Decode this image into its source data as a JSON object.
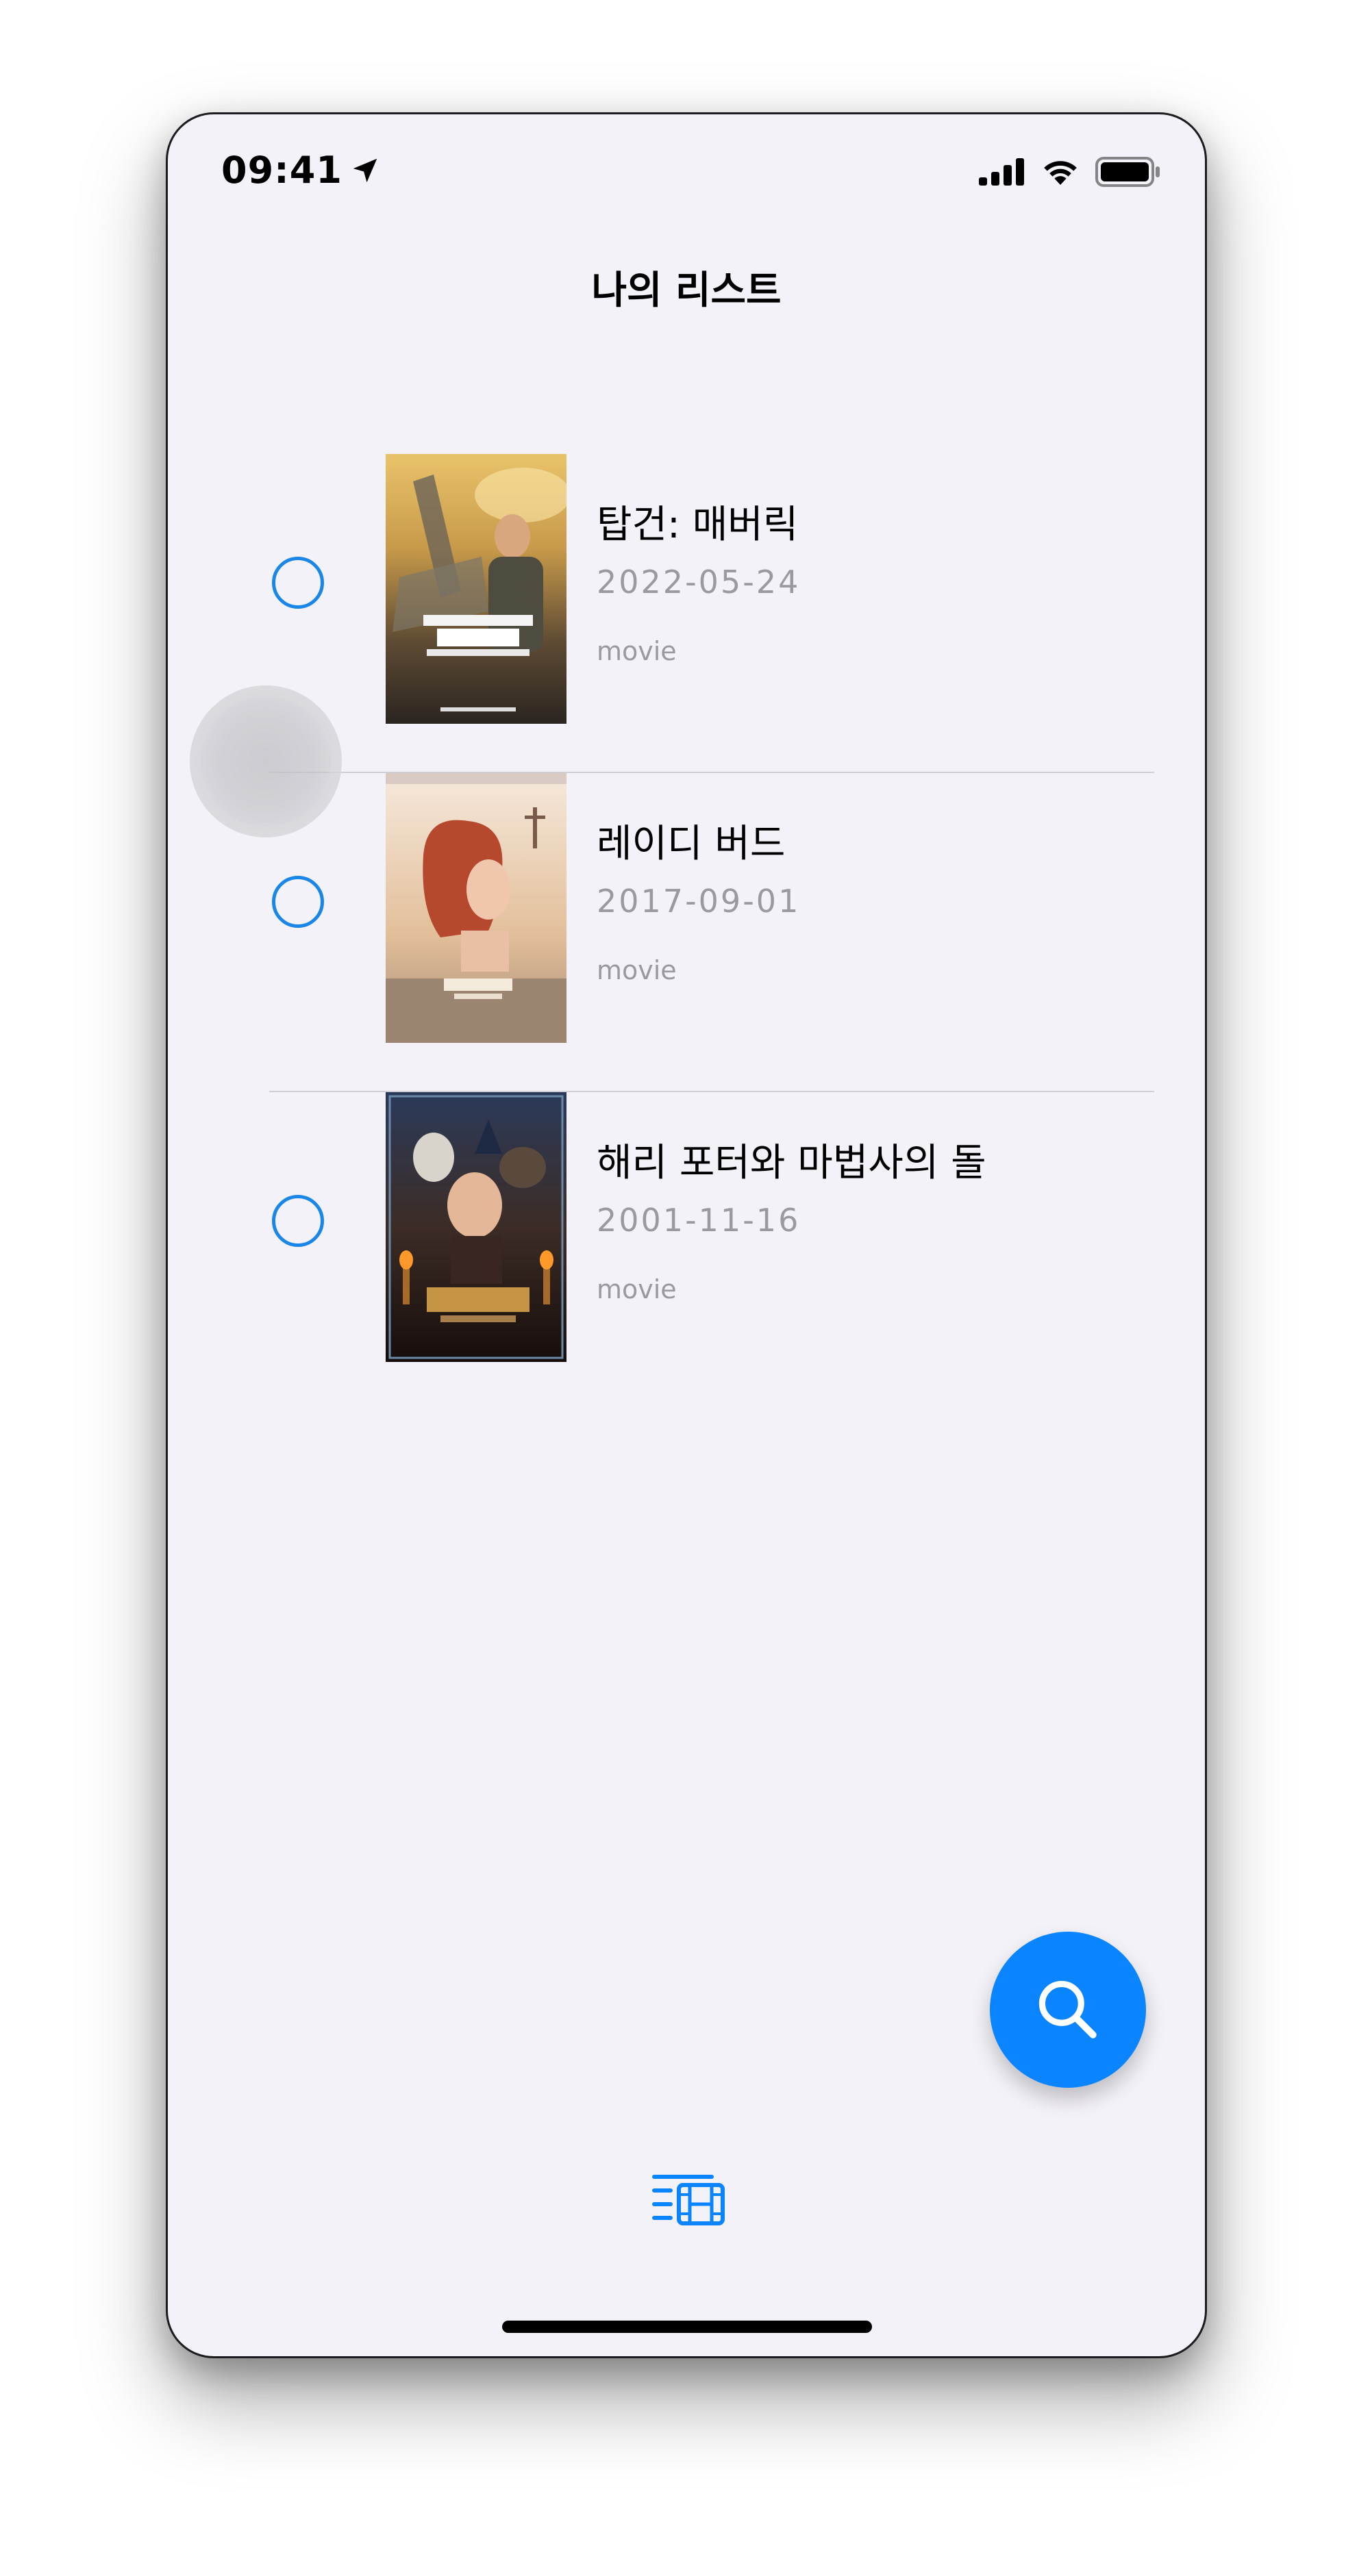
{
  "status_bar": {
    "time": "09:41"
  },
  "nav": {
    "title": "나의 리스트"
  },
  "items": [
    {
      "title": "탑건: 매버릭",
      "date": "2022-05-24",
      "type": "movie",
      "checked": false
    },
    {
      "title": "레이디 버드",
      "date": "2017-09-01",
      "type": "movie",
      "checked": false
    },
    {
      "title": "해리 포터와 마법사의 돌",
      "date": "2001-11-16",
      "type": "movie",
      "checked": false
    }
  ],
  "icons": {
    "fab": "search-icon",
    "tab": "film-list-icon",
    "status": [
      "location-arrow-icon",
      "signal-icon",
      "wifi-icon",
      "battery-icon"
    ]
  },
  "colors": {
    "accent": "#0a84ff",
    "radio": "#1a86e8",
    "background": "#f3f2f8",
    "secondary_text": "#9a9a9e"
  }
}
